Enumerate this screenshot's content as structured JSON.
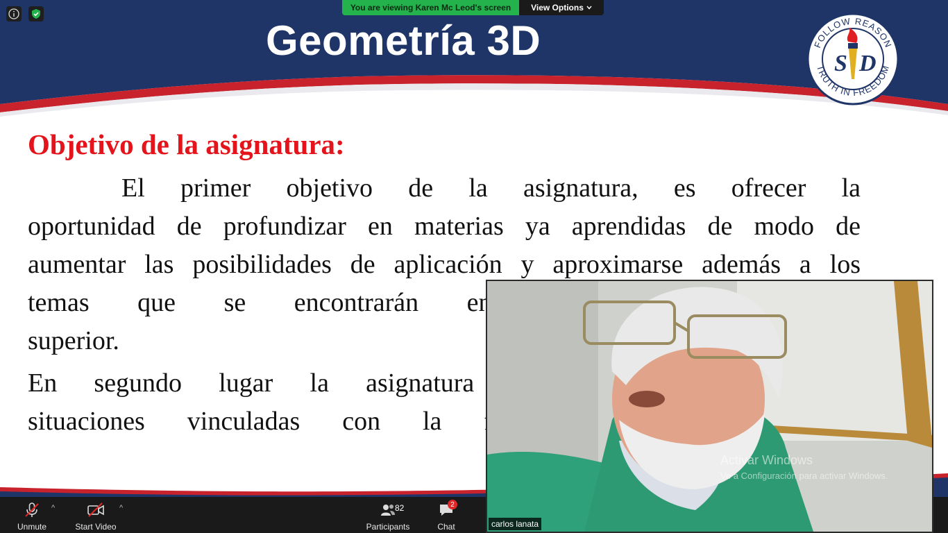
{
  "banner": {
    "viewing_text": "You are viewing Karen Mc Leod's screen",
    "view_options_label": "View Options"
  },
  "slide": {
    "title": "Geometría 3D",
    "logo": {
      "text_top": "FOLLOW REASON",
      "text_bottom": "TRUTH IN FREEDOM",
      "monogram_left": "S",
      "monogram_right": "D"
    },
    "heading": "Objetivo de la asignatura:",
    "paragraph1": [
      "El primer objetivo de la asignatura, es ofrecer la",
      "oportunidad de profundizar en materias ya aprendidas de modo de",
      "aumentar las posibilidades de aplicación y aproximarse además a los",
      "temas que se encontrarán en los cursos de nivel",
      "superior."
    ],
    "paragraph2": [
      "En segundo lugar la asignatura pretende que se estudien",
      "situaciones vinculadas con la forma, tamaño y posición"
    ]
  },
  "video": {
    "participant_name": "carlos lanata",
    "watermark_title": "Activar Windows",
    "watermark_sub": "Ve a Configuración para activar Windows."
  },
  "toolbar": {
    "unmute_label": "Unmute",
    "start_video_label": "Start Video",
    "participants_label": "Participants",
    "participants_count": "82",
    "chat_label": "Chat",
    "chat_badge": "2"
  },
  "colors": {
    "slide_navy": "#1f3567",
    "slide_red": "#c8232c",
    "heading_red": "#e3141b",
    "banner_green": "#23b24c"
  }
}
